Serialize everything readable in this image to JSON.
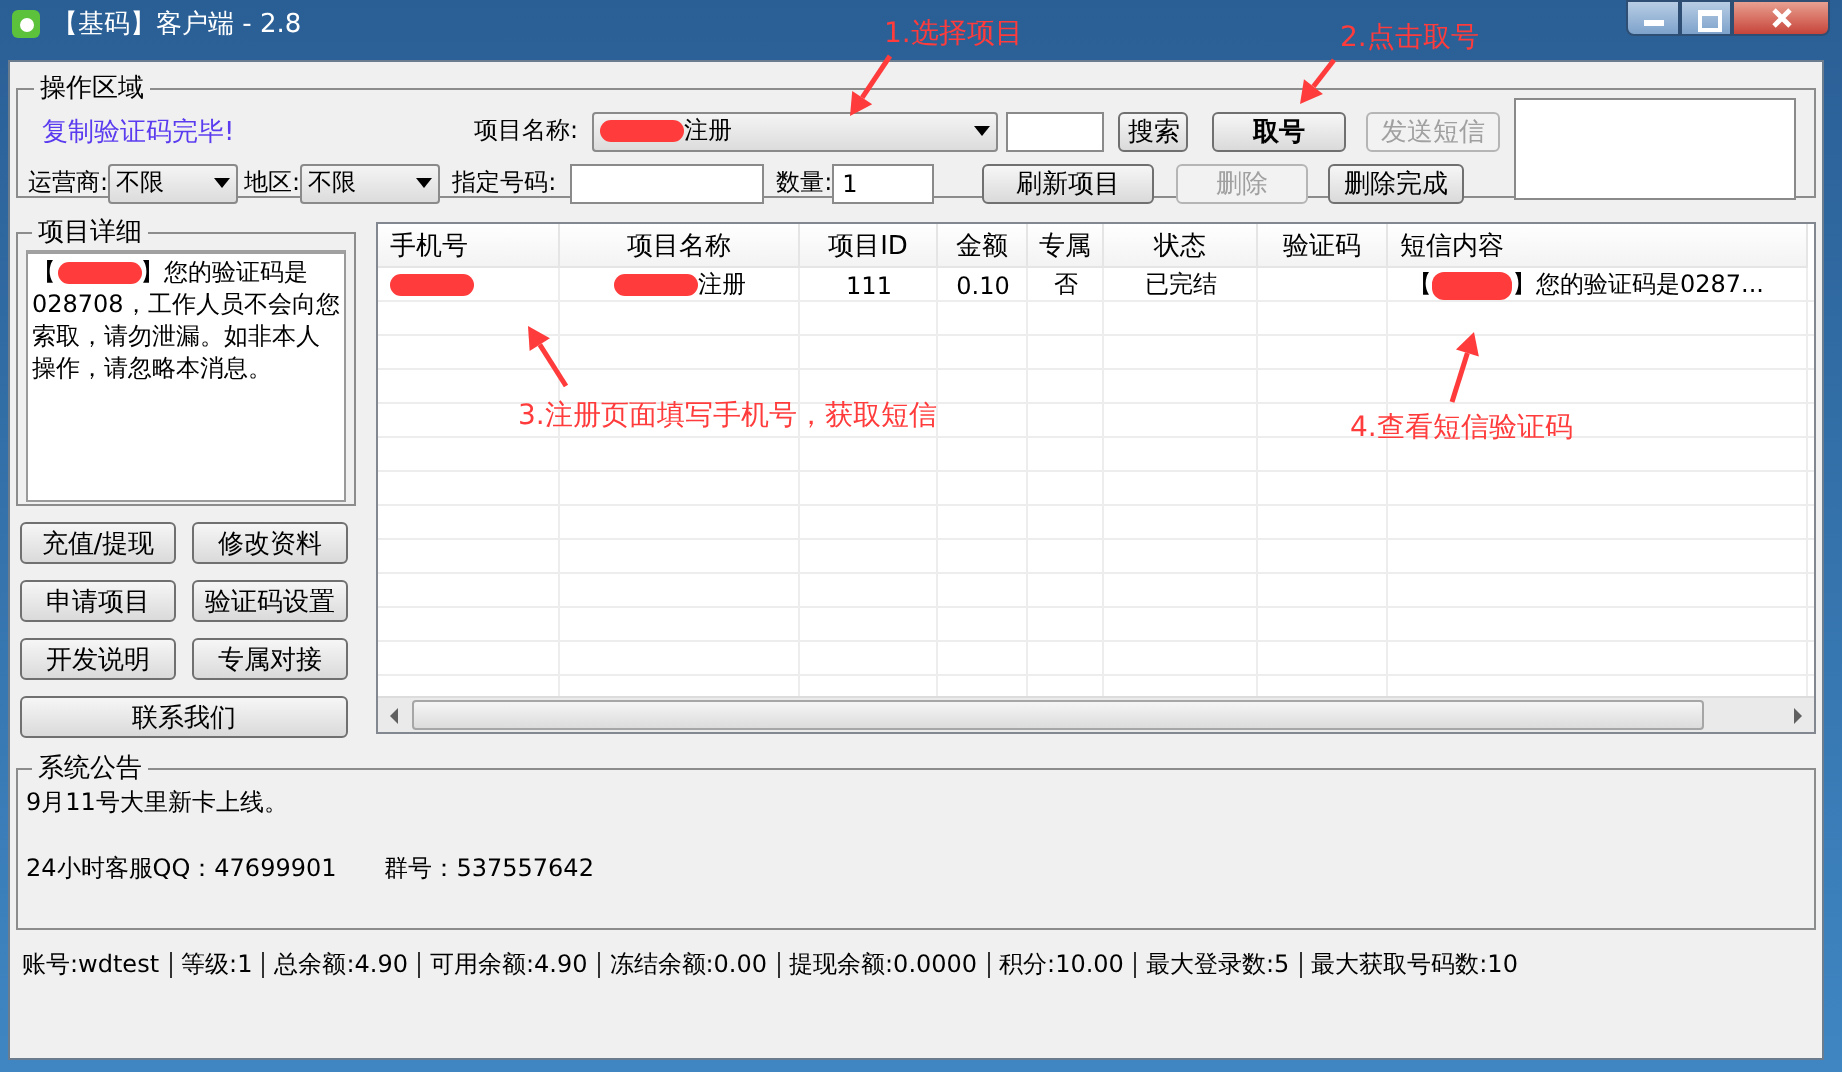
{
  "window": {
    "title": "【基码】客户端 - 2.8"
  },
  "operation": {
    "title": "操作区域",
    "notice": "复制验证码完毕!",
    "project_label": "项目名称:",
    "project_value": "注册",
    "project_redacted": true,
    "carrier_label": "运营商:",
    "carrier_value": "不限",
    "region_label": "地区:",
    "region_value": "不限",
    "number_label": "指定号码:",
    "quantity_label": "数量:",
    "quantity_value": "1",
    "top_buttons": [
      {
        "label": "搜索",
        "disabled": false,
        "bold": false
      },
      {
        "label": "取号",
        "disabled": false,
        "bold": true
      },
      {
        "label": "发送短信",
        "disabled": true,
        "bold": false
      }
    ],
    "bottom_buttons": [
      {
        "label": "刷新项目",
        "disabled": false,
        "bold": false
      },
      {
        "label": "删除",
        "disabled": true,
        "bold": false
      },
      {
        "label": "删除完成",
        "disabled": false,
        "bold": false
      }
    ]
  },
  "details": {
    "title": "项目详细",
    "prefix": "【",
    "redacted": true,
    "text": "】您的验证码是028708，工作人员不会向您索取，请勿泄漏。如非本人操作，请忽略本消息。"
  },
  "side_buttons": [
    "充值/提现",
    "修改资料",
    "申请项目",
    "验证码设置",
    "开发说明",
    "专属对接",
    "联系我们"
  ],
  "table": {
    "columns": [
      "手机号",
      "项目名称",
      "项目ID",
      "金额",
      "专属",
      "状态",
      "验证码",
      "短信内容"
    ],
    "rows": [
      {
        "phone_redacted": true,
        "project": "注册",
        "project_redacted": true,
        "project_id": "111",
        "amount": "0.10",
        "exclusive": "否",
        "status": "已完结",
        "sms_prefix": "【",
        "sms_redacted": true,
        "sms": "】您的验证码是0287..."
      }
    ]
  },
  "announcement": {
    "title": "系统公告",
    "lines": [
      "9月11号大里新卡上线。",
      "24小时客服QQ：47699901　　群号：537557642"
    ]
  },
  "status_bar": [
    "账号:wdtest",
    "等级:1",
    "总余额:4.90",
    "可用余额:4.90",
    "冻结余额:0.00",
    "提现余额:0.0000",
    "积分:10.00",
    "最大登录数:5",
    "最大获取号码数:10"
  ],
  "annotations": [
    "1.选择项目",
    "2.点击取号",
    "3.注册页面填写手机号，获取短信",
    "4.查看短信验证码"
  ]
}
